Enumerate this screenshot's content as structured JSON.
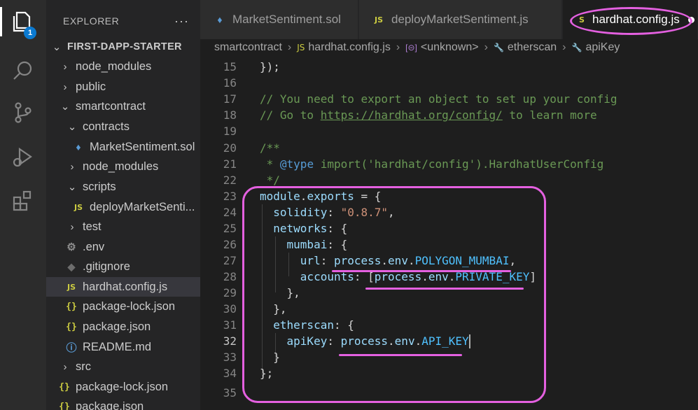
{
  "activity_bar": {
    "explorer_badge": "1"
  },
  "sidebar": {
    "title": "EXPLORER",
    "more": "···",
    "tree": [
      {
        "label": "FIRST-DAPP-STARTER",
        "kind": "root"
      },
      {
        "label": "node_modules",
        "kind": "folder"
      },
      {
        "label": "public",
        "kind": "folder"
      },
      {
        "label": "smartcontract",
        "kind": "folder"
      },
      {
        "label": "contracts",
        "kind": "folder"
      },
      {
        "label": "MarketSentiment.sol",
        "kind": "sol"
      },
      {
        "label": "node_modules",
        "kind": "folder"
      },
      {
        "label": "scripts",
        "kind": "folder"
      },
      {
        "label": "deployMarketSentiment.js",
        "display": "deployMarketSenti...",
        "kind": "js"
      },
      {
        "label": "test",
        "kind": "folder"
      },
      {
        "label": ".env",
        "kind": "env"
      },
      {
        "label": ".gitignore",
        "kind": "git"
      },
      {
        "label": "hardhat.config.js",
        "kind": "js"
      },
      {
        "label": "package-lock.json",
        "kind": "json"
      },
      {
        "label": "package.json",
        "kind": "json"
      },
      {
        "label": "README.md",
        "kind": "info"
      },
      {
        "label": "src",
        "kind": "folder"
      },
      {
        "label": "package-lock.json",
        "kind": "json"
      },
      {
        "label": "package.json",
        "kind": "json"
      }
    ],
    "icons": {
      "js": "JS",
      "json": "{}",
      "chev_right": "›",
      "chev_down": "⌄"
    }
  },
  "tabs": [
    {
      "label": "MarketSentiment.sol"
    },
    {
      "label": "deployMarketSentiment.js"
    },
    {
      "label": "hardhat.config.js"
    }
  ],
  "breadcrumb": {
    "parts": [
      "smartcontract",
      "hardhat.config.js",
      "<unknown>",
      "etherscan",
      "apiKey"
    ],
    "sep": "›",
    "js_icon": "JS"
  },
  "editor": {
    "line_numbers": [
      "15",
      "16",
      "17",
      "18",
      "19",
      "20",
      "21",
      "22",
      "23",
      "24",
      "25",
      "26",
      "27",
      "28",
      "29",
      "30",
      "31",
      "32",
      "33",
      "34",
      "35"
    ],
    "current_line": "32",
    "tokens": {
      "l15": "});",
      "l17": "// You need to export an object to set up your config",
      "l18a": "// Go to ",
      "l18b": "https://hardhat.org/config/",
      "l18c": " to learn more",
      "l20": "/**",
      "l21a": " * ",
      "l21b": "@type",
      "l21c": " import('hardhat/config').HardhatUserConfig",
      "l22": " */",
      "module": "module",
      "exports": "exports",
      "solidity": "solidity",
      "solidity_value": "\"0.8.7\"",
      "networks": "networks",
      "mumbai": "mumbai",
      "url": "url",
      "accounts": "accounts",
      "process": "process",
      "env": "env",
      "polygon_mumbai": "POLYGON_MUMBAI",
      "private_key": "PRIVATE_KEY",
      "etherscan": "etherscan",
      "apiKey": "apiKey",
      "api_key": "API_KEY"
    }
  },
  "colors": {
    "highlight": "#e460e0",
    "accent": "#0b7ad1"
  }
}
